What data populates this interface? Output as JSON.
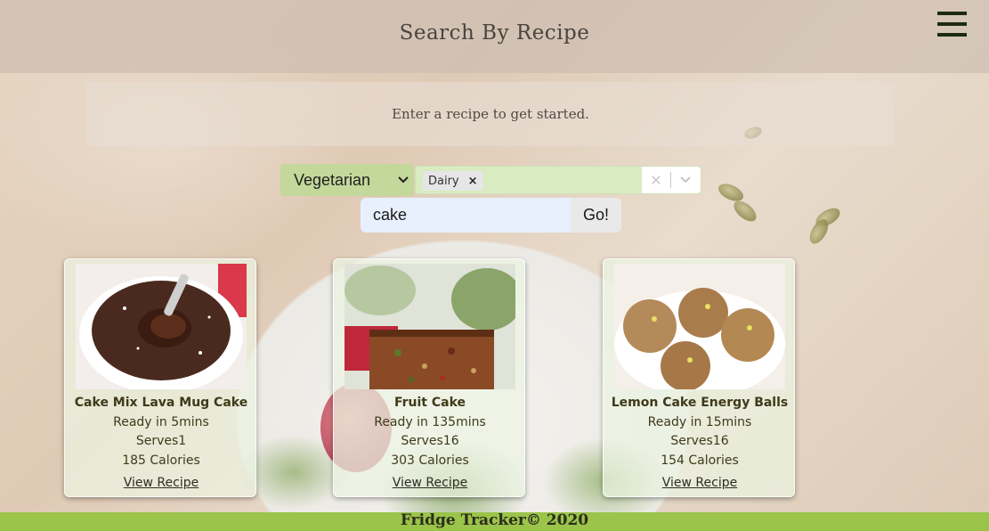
{
  "header": {
    "title": "Search By Recipe",
    "menu_icon": "hamburger-menu-icon"
  },
  "intro": {
    "text": "Enter a recipe to get started."
  },
  "filters": {
    "diet_selected": "Vegetarian",
    "intolerance_tags": [
      "Dairy"
    ],
    "tag_remove_glyph": "×",
    "clear_glyph": "✕",
    "dropdown_glyph": "⌄"
  },
  "search": {
    "value": "cake",
    "button_label": "Go!"
  },
  "recipes": [
    {
      "title": "Cake Mix Lava Mug Cake",
      "ready": "Ready in 5mins",
      "serves": "Serves1",
      "calories": "185 Calories",
      "link": "View Recipe"
    },
    {
      "title": "Fruit Cake",
      "ready": "Ready in 135mins",
      "serves": "Serves16",
      "calories": "303 Calories",
      "link": "View Recipe"
    },
    {
      "title": "Lemon Cake Energy Balls",
      "ready": "Ready in 15mins",
      "serves": "Serves16",
      "calories": "154 Calories",
      "link": "View Recipe"
    }
  ],
  "footer": {
    "text": "Fridge Tracker© 2020"
  },
  "colors": {
    "header_bg": "#cdbeb2",
    "select_bg": "#c3d89a",
    "footer_bg": "#9ac44a",
    "menu_icon": "#1d2a13"
  }
}
